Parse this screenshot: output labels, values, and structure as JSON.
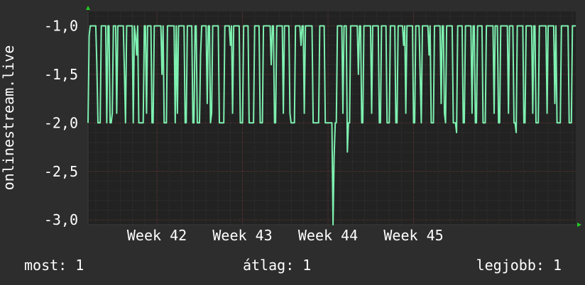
{
  "chart_data": {
    "type": "line",
    "ylabel": "onlinestream.live",
    "ylim": [
      -3.05,
      -0.85
    ],
    "yticks": [
      -1.0,
      -1.5,
      -2.0,
      -2.5,
      -3.0
    ],
    "ytick_labels": [
      "-1,0",
      "-1,5",
      "-2,0",
      "-2,5",
      "-3,0"
    ],
    "xlim": [
      0,
      439
    ],
    "xticks": [
      62,
      139,
      216,
      293
    ],
    "xtick_labels": [
      "Week 42",
      "Week 43",
      "Week 44",
      "Week 45"
    ],
    "grid": true,
    "colors": {
      "background": "#2d2d2d",
      "plot": "#222222",
      "grid_major": "#5a2d2d",
      "grid_minor": "#3a3a3a",
      "line": "#7ef0b0",
      "axis_arrow": "#22cc22",
      "text": "#ffffff"
    },
    "series": [
      {
        "values": [
          -2.0,
          -1.1,
          -1.0,
          -1.0,
          -1.0,
          -1.0,
          -1.0,
          -1.0,
          -1.4,
          -2.0,
          -2.0,
          -2.0,
          -1.0,
          -1.0,
          -1.0,
          -1.0,
          -1.0,
          -2.0,
          -1.0,
          -1.0,
          -2.0,
          -2.0,
          -1.9,
          -1.0,
          -1.0,
          -1.0,
          -1.9,
          -1.0,
          -1.0,
          -1.0,
          -1.0,
          -1.0,
          -1.0,
          -1.5,
          -2.0,
          -1.0,
          -1.0,
          -1.0,
          -1.0,
          -1.0,
          -1.0,
          -2.0,
          -1.0,
          -1.1,
          -1.3,
          -1.0,
          -2.0,
          -2.0,
          -2.0,
          -2.0,
          -2.0,
          -1.0,
          -1.0,
          -1.9,
          -1.0,
          -1.0,
          -1.0,
          -1.0,
          -2.0,
          -2.0,
          -1.0,
          -1.0,
          -1.0,
          -1.0,
          -1.0,
          -1.0,
          -1.0,
          -1.5,
          -1.0,
          -2.0,
          -2.0,
          -2.0,
          -1.0,
          -1.0,
          -1.0,
          -1.0,
          -1.0,
          -1.0,
          -1.0,
          -2.0,
          -1.0,
          -1.9,
          -1.0,
          -1.0,
          -1.0,
          -1.0,
          -1.0,
          -1.0,
          -2.0,
          -2.0,
          -1.0,
          -1.0,
          -1.0,
          -1.0,
          -1.0,
          -2.0,
          -2.0,
          -1.0,
          -1.0,
          -2.0,
          -2.0,
          -2.0,
          -1.3,
          -1.0,
          -1.0,
          -1.0,
          -1.0,
          -1.0,
          -1.8,
          -1.0,
          -1.0,
          -2.0,
          -1.9,
          -1.0,
          -1.0,
          -1.0,
          -1.0,
          -1.0,
          -1.0,
          -2.0,
          -2.0,
          -2.0,
          -2.0,
          -2.0,
          -1.0,
          -1.0,
          -1.0,
          -1.0,
          -1.0,
          -1.2,
          -1.0,
          -1.9,
          -1.0,
          -1.0,
          -1.0,
          -1.0,
          -1.0,
          -1.0,
          -2.0,
          -2.0,
          -2.0,
          -1.0,
          -1.0,
          -1.0,
          -1.0,
          -1.0,
          -2.0,
          -2.0,
          -2.0,
          -2.0,
          -2.0,
          -1.0,
          -1.0,
          -1.0,
          -1.0,
          -1.0,
          -2.0,
          -2.0,
          -2.0,
          -1.0,
          -1.0,
          -1.0,
          -1.0,
          -1.0,
          -1.0,
          -1.0,
          -1.4,
          -1.0,
          -1.0,
          -2.0,
          -2.0,
          -1.0,
          -1.0,
          -1.0,
          -1.0,
          -1.0,
          -1.0,
          -1.9,
          -1.0,
          -1.0,
          -1.0,
          -1.0,
          -1.0,
          -1.9,
          -2.0,
          -2.0,
          -2.0,
          -2.0,
          -1.0,
          -1.0,
          -1.0,
          -1.0,
          -1.0,
          -1.2,
          -1.0,
          -1.0,
          -1.9,
          -1.0,
          -1.0,
          -1.0,
          -1.0,
          -1.0,
          -1.0,
          -1.0,
          -2.0,
          -2.0,
          -2.0,
          -2.0,
          -2.0,
          -2.0,
          -1.0,
          -1.0,
          -1.0,
          -1.0,
          -1.0,
          -2.0,
          -2.0,
          -2.0,
          -2.0,
          -2.0,
          -2.0,
          -2.0,
          -3.05,
          -2.35,
          -2.0,
          -2.0,
          -1.0,
          -1.0,
          -1.0,
          -1.0,
          -1.0,
          -1.9,
          -1.0,
          -1.0,
          -1.0,
          -2.3,
          -2.0,
          -2.0,
          -1.0,
          -1.0,
          -1.0,
          -1.0,
          -1.0,
          -1.0,
          -1.0,
          -1.5,
          -1.0,
          -1.0,
          -2.0,
          -2.0,
          -1.0,
          -1.0,
          -1.0,
          -1.0,
          -1.0,
          -1.0,
          -1.0,
          -1.9,
          -1.0,
          -1.0,
          -1.0,
          -1.0,
          -1.0,
          -1.0,
          -2.0,
          -2.0,
          -1.0,
          -1.0,
          -1.0,
          -1.0,
          -1.0,
          -2.0,
          -2.0,
          -2.0,
          -1.0,
          -1.0,
          -1.0,
          -1.0,
          -1.0,
          -2.0,
          -2.0,
          -1.0,
          -1.0,
          -1.0,
          -1.0,
          -1.0,
          -1.2,
          -1.0,
          -1.9,
          -1.0,
          -1.0,
          -1.0,
          -1.0,
          -1.0,
          -1.0,
          -2.0,
          -2.0,
          -1.0,
          -1.0,
          -1.0,
          -1.0,
          -1.5,
          -2.0,
          -1.0,
          -1.0,
          -1.0,
          -1.0,
          -1.0,
          -1.0,
          -1.3,
          -1.0,
          -2.0,
          -2.0,
          -2.0,
          -1.0,
          -1.0,
          -1.0,
          -1.0,
          -1.0,
          -1.0,
          -1.8,
          -1.0,
          -1.0,
          -1.9,
          -2.0,
          -1.0,
          -1.0,
          -1.0,
          -1.0,
          -1.0,
          -1.0,
          -2.0,
          -2.0,
          -2.0,
          -2.1,
          -1.0,
          -1.0,
          -1.0,
          -1.0,
          -1.0,
          -2.0,
          -2.0,
          -1.0,
          -1.0,
          -1.0,
          -1.0,
          -1.0,
          -1.0,
          -1.9,
          -1.0,
          -1.0,
          -2.0,
          -2.0,
          -1.0,
          -1.0,
          -1.0,
          -1.0,
          -1.0,
          -2.0,
          -2.0,
          -2.0,
          -1.0,
          -1.0,
          -1.0,
          -1.0,
          -1.0,
          -1.0,
          -1.0,
          -1.9,
          -1.0,
          -1.0,
          -1.0,
          -2.0,
          -2.0,
          -1.0,
          -1.0,
          -1.0,
          -1.0,
          -1.0,
          -1.0,
          -1.0,
          -1.9,
          -1.0,
          -1.0,
          -1.0,
          -1.0,
          -2.0,
          -2.0,
          -2.1,
          -1.0,
          -1.0,
          -1.0,
          -1.0,
          -1.0,
          -1.0,
          -2.0,
          -2.0,
          -1.0,
          -1.0,
          -1.0,
          -1.0,
          -1.0,
          -1.0,
          -1.9,
          -1.0,
          -1.0,
          -2.0,
          -2.0,
          -2.0,
          -1.0,
          -1.0,
          -1.0,
          -1.0,
          -1.0,
          -1.0,
          -1.0,
          -1.9,
          -1.0,
          -1.0,
          -1.0,
          -1.0,
          -1.0,
          -1.0,
          -1.8,
          -1.0,
          -2.0,
          -2.0,
          -2.0,
          -2.0,
          -1.0,
          -1.0,
          -1.0,
          -1.0,
          -1.0,
          -1.0,
          -1.0,
          -2.0,
          -2.0,
          -2.0,
          -1.0,
          -1.0,
          -1.0,
          -1.0
        ]
      }
    ]
  },
  "stats": {
    "current": "most: 1",
    "average": "átlag: 1",
    "best": "legjobb: 1"
  }
}
